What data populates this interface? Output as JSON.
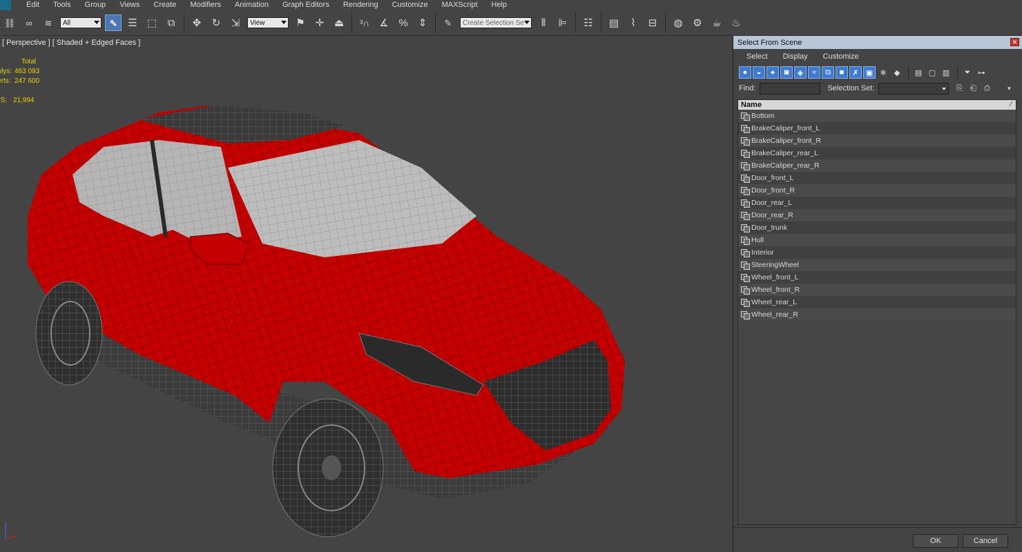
{
  "menubar": [
    "Edit",
    "Tools",
    "Group",
    "Views",
    "Create",
    "Modifiers",
    "Animation",
    "Graph Editors",
    "Rendering",
    "Customize",
    "MAXScript",
    "Help"
  ],
  "toolbar": {
    "selection_filter": "All",
    "coord_system": "View",
    "selection_set": "Create Selection Se"
  },
  "viewport": {
    "label": "[ Perspective ] [ Shaded + Edged Faces ]",
    "stats": {
      "header": "Total",
      "polys_label": "Polys:",
      "polys_value": "463 093",
      "verts_label": "Verts:",
      "verts_value": "247 600",
      "fps_label": "FPS:",
      "fps_value": "21,994"
    }
  },
  "dialog": {
    "title": "Select From Scene",
    "menu": [
      "Select",
      "Display",
      "Customize"
    ],
    "find_label": "Find:",
    "selection_set_label": "Selection Set:",
    "list_header": "Name",
    "objects": [
      "Bottom",
      "BrakeCaliper_front_L",
      "BrakeCaliper_front_R",
      "BrakeCaliper_rear_L",
      "BrakeCaliper_rear_R",
      "Door_front_L",
      "Door_front_R",
      "Door_rear_L",
      "Door_rear_R",
      "Door_trunk",
      "Hull",
      "Interior",
      "SteeringWheel",
      "Wheel_front_L",
      "Wheel_front_R",
      "Wheel_rear_L",
      "Wheel_rear_R"
    ],
    "ok_label": "OK",
    "cancel_label": "Cancel"
  },
  "colors": {
    "car_paint": "#c40000",
    "wire": "#555555",
    "selection_blue": "#3e7ad0",
    "stats_yellow": "#e7d400",
    "title_bar": "#b9c6d8"
  }
}
